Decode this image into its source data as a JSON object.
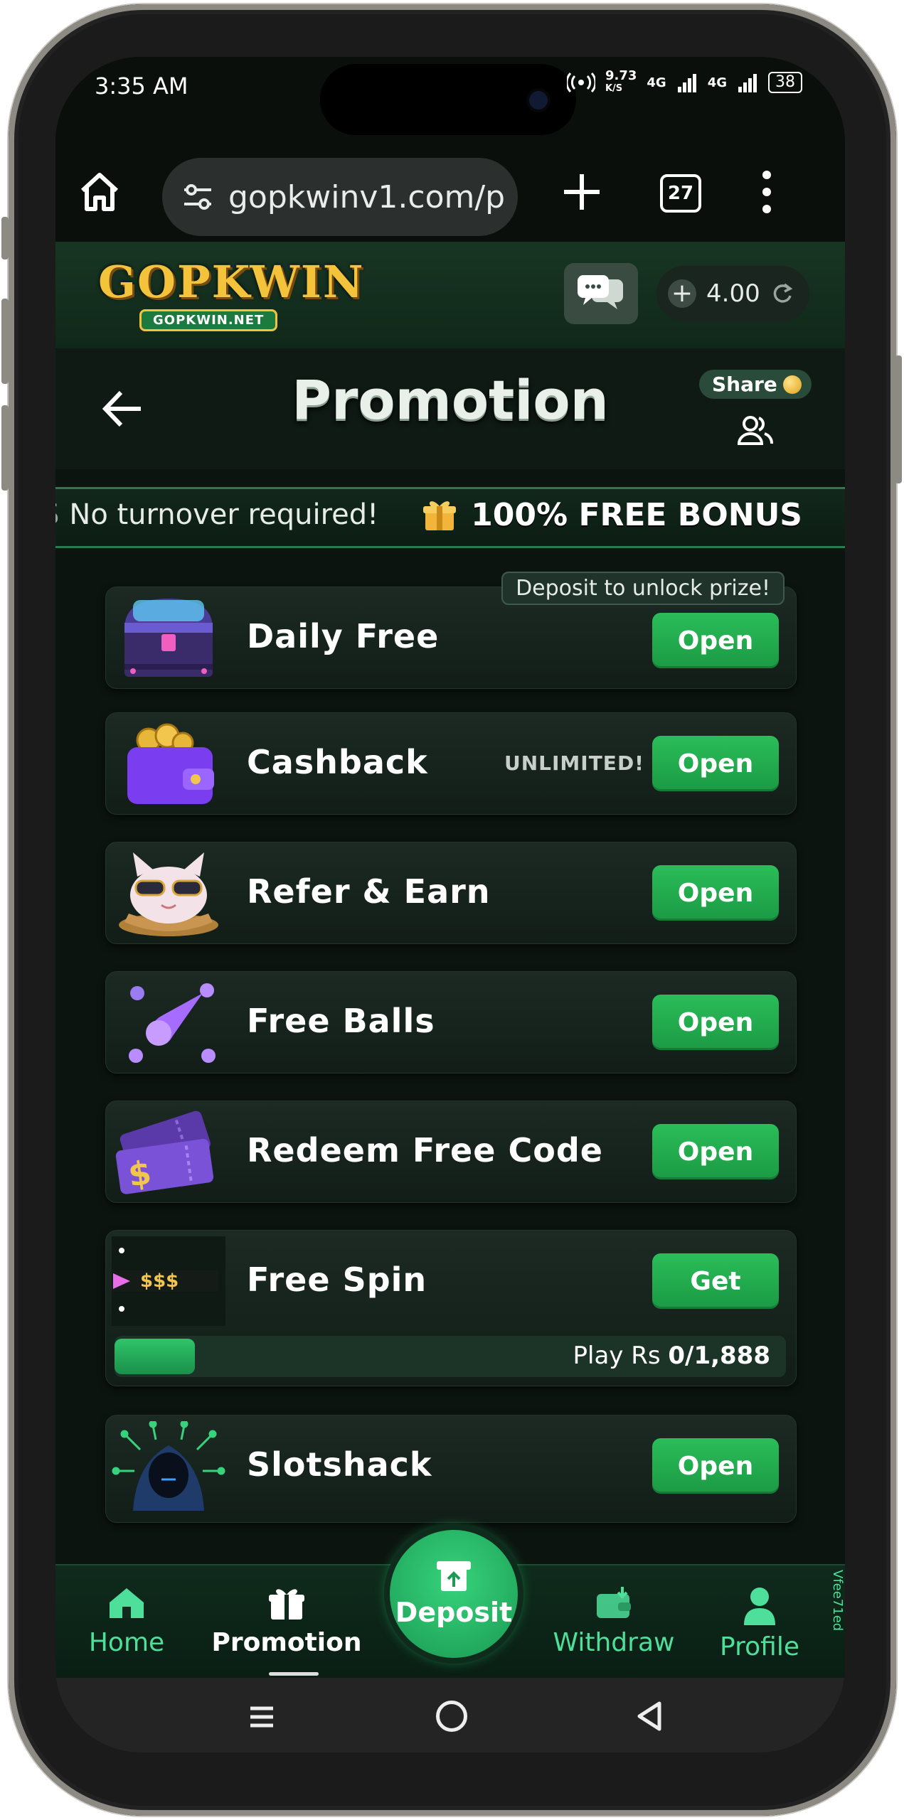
{
  "status_bar": {
    "time": "3:35 AM",
    "net_speed_value": "9.73",
    "net_speed_unit": "K/S",
    "sim1": "4G",
    "sim2": "4G",
    "battery": "38"
  },
  "browser": {
    "url": "gopkwinv1.com/p",
    "tab_count": "27"
  },
  "site": {
    "logo_main": "GOPKWIN",
    "logo_sub": "GOPKWIN.NET",
    "balance": "4.00",
    "balance_plus": "+"
  },
  "page": {
    "title": "Promotion",
    "share_label": "Share"
  },
  "marquee": {
    "lead_fragment": "S",
    "text": "No turnover required!",
    "bonus": "100% FREE BONUS"
  },
  "promotions": [
    {
      "name": "Daily Free",
      "button": "Open",
      "tag": "Deposit to unlock prize!",
      "icon": "treasure-chest-icon"
    },
    {
      "name": "Cashback",
      "button": "Open",
      "note": "UNLIMITED!",
      "icon": "wallet-coins-icon"
    },
    {
      "name": "Refer & Earn",
      "button": "Open",
      "icon": "cat-sunglasses-icon"
    },
    {
      "name": "Free Balls",
      "button": "Open",
      "icon": "comet-balls-icon"
    },
    {
      "name": "Redeem Free Code",
      "button": "Open",
      "icon": "ticket-icon"
    },
    {
      "name": "Free Spin",
      "button": "Get",
      "icon": "slot-reel-icon",
      "reel_text": "$$$",
      "progress": {
        "prefix": "Play Rs ",
        "current": "0",
        "target": "1,888",
        "display": "0/1,888",
        "fill_fraction": 0.12
      }
    },
    {
      "name": "Slotshack",
      "button": "Open",
      "icon": "hacker-icon"
    }
  ],
  "bottom_nav": {
    "home": "Home",
    "promotion": "Promotion",
    "deposit": "Deposit",
    "withdraw": "Withdraw",
    "profile": "Profile",
    "side_code": "Vfee71ed"
  },
  "colors": {
    "accent_green": "#2bbd59",
    "nav_green": "#4ee09a",
    "background": "#0c1410",
    "logo_gold": "#f3c43b"
  }
}
